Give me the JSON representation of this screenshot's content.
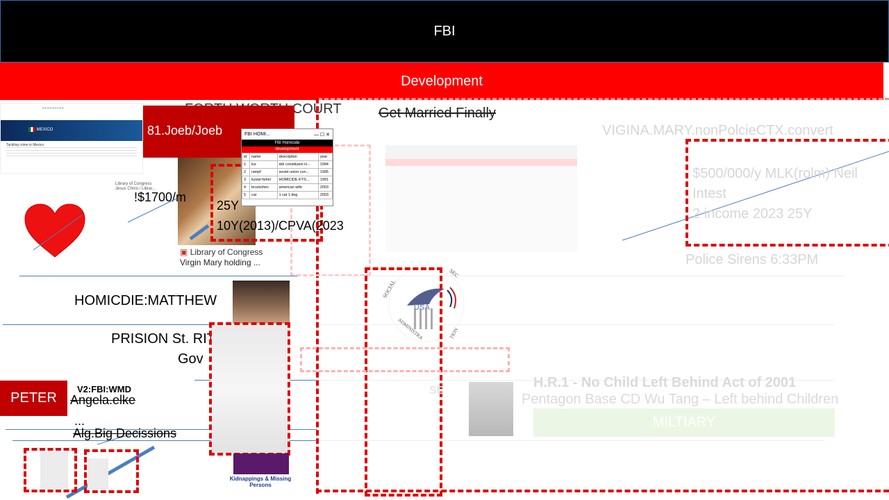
{
  "header": {
    "title": "FBI",
    "subtitle": "Development"
  },
  "left_panel": {
    "court_text": "FORTH WORTH COURT",
    "joeb_label": "81.Joeb/Joeb",
    "salary": "!$1700/m",
    "years_partial": "25Y",
    "cpva": "10Y(2013)/CPVA(2023",
    "painting_source": "Library of Congress",
    "painting_caption": "Virgin Mary holding ...",
    "gov_thumb": {
      "banner": "MEXICO",
      "section": "Tackling crime in Mexico",
      "caption_source": "Library of Congress",
      "caption": "Jesus Christ / Librar..."
    },
    "homicide": "HOMICDIE:MATTHEW",
    "prison": "PRISION St. RIT",
    "gov": "Gov",
    "peter": "PETER",
    "v2": "V2:FBI:WMD",
    "angela": "Angela.elke",
    "ellipsis": "...",
    "alg": "Alg.Big Decissions",
    "kidnap": "Kidnappings & Missing Persons"
  },
  "popup": {
    "window_title": "FBI HOMI...",
    "heading": "FBI Homicide",
    "subheading": "development",
    "columns": [
      "id",
      "name",
      "description",
      "year"
    ],
    "rows": [
      [
        "1",
        "lux",
        "ddr constituion H...",
        "1994"
      ],
      [
        "2",
        "rampf",
        "soviet union con...",
        "1995"
      ],
      [
        "3",
        "kystal fisher",
        "HOMICIDE KYS...",
        "1991"
      ],
      [
        "4",
        "bruckshen",
        "american wife",
        "2003"
      ],
      [
        "5",
        "cat",
        "1 cat 1 dog",
        "2003"
      ]
    ]
  },
  "right_panel": {
    "married": "Get Married Finally",
    "virgina": "VIGINA.MARY.nonPolcieCTX.convert",
    "income_line1": "$500/000/y MLK(rolm) Neil",
    "income_line2": "Intest",
    "income_line3": "2 income 2023 25Y",
    "sirens": "Police Sirens 6:33PM",
    "seal_text": "SOCIAL SECURITY ADMINISTRATION",
    "seal_usa": "USA",
    "hr1": "H.R.1 - No Child Left Behind Act of 2001",
    "pentagon": "Pentagon Base CD Wu Tang – Left behind Children",
    "miltiary": "MILTIARY",
    "small_se": "SE"
  },
  "colors": {
    "header_bg": "#000000",
    "dev_bar": "#ff0000",
    "maroon": "#c00000",
    "dashed": "#e00000",
    "line": "#4a7fc0"
  }
}
